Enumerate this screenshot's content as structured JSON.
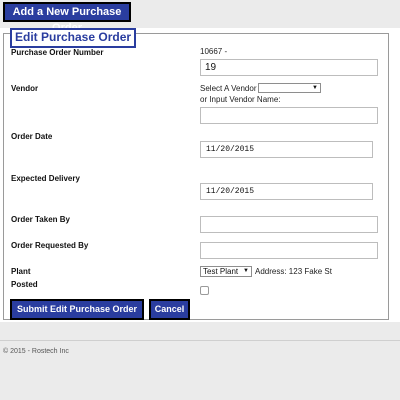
{
  "header": {
    "add_button_label": "Add a New Purchase Order"
  },
  "form": {
    "legend": "Edit Purchase Order",
    "po_number": {
      "label": "Purchase Order Number",
      "prefix": "10667 -",
      "value": "19"
    },
    "vendor": {
      "label": "Vendor",
      "select_label": "Select A Vendor",
      "selected_value": "",
      "alt_label": "or Input Vendor Name:",
      "alt_value": ""
    },
    "order_date": {
      "label": "Order Date",
      "value": "11/20/2015"
    },
    "expected_delivery": {
      "label": "Expected Delivery",
      "value": "11/20/2015"
    },
    "order_taken_by": {
      "label": "Order Taken By",
      "value": ""
    },
    "order_requested_by": {
      "label": "Order Requested By",
      "value": ""
    },
    "plant": {
      "label": "Plant",
      "selected_value": "Test Plant",
      "address_text": "Address: 123 Fake St"
    },
    "posted": {
      "label": "Posted",
      "checked": false
    },
    "submit_label": "Submit Edit Purchase Order",
    "cancel_label": "Cancel"
  },
  "footer": {
    "copyright": "© 2015 - Rostech Inc"
  },
  "icons": {
    "dropdown": "chevron-down-icon"
  }
}
